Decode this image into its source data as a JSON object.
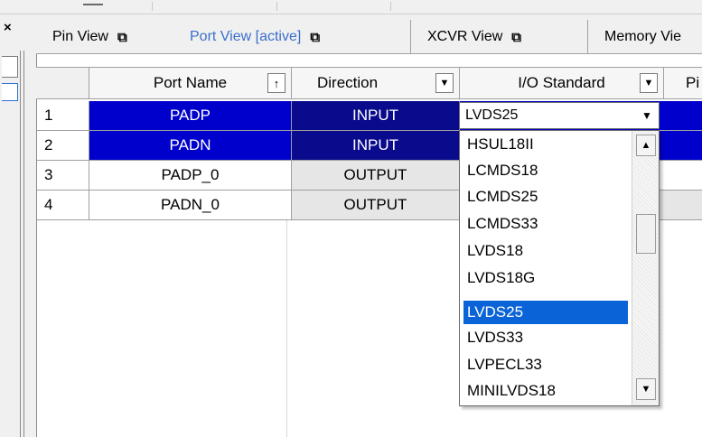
{
  "tabs": [
    {
      "label": "Pin View",
      "active": false
    },
    {
      "label": "Port View [active]",
      "active": true
    },
    {
      "label": "XCVR View",
      "active": false
    },
    {
      "label": "Memory Vie",
      "active": false
    }
  ],
  "table": {
    "columns": [
      "Port Name",
      "Direction",
      "I/O Standard",
      "Pi"
    ],
    "sort_indicator": "↑",
    "dropdown_indicator": "▼",
    "rows": [
      {
        "index": "1",
        "port_name": "PADP",
        "direction": "INPUT",
        "io_standard": "LVDS25"
      },
      {
        "index": "2",
        "port_name": "PADN",
        "direction": "INPUT",
        "io_standard": ""
      },
      {
        "index": "3",
        "port_name": "PADP_0",
        "direction": "OUTPUT",
        "io_standard": ""
      },
      {
        "index": "4",
        "port_name": "PADN_0",
        "direction": "OUTPUT",
        "io_standard": ""
      }
    ]
  },
  "io_dropdown": {
    "selected_value": "LVDS25",
    "options": [
      "HSUL18II",
      "LCMDS18",
      "LCMDS25",
      "LCMDS33",
      "LVDS18",
      "LVDS18G",
      "LVDS25",
      "LVDS33",
      "LVPECL33",
      "MINILVDS18"
    ],
    "highlighted": "LVDS25"
  },
  "icons": {
    "window": "restore-window-icon",
    "close": "close-icon"
  },
  "colors": {
    "row_selected": "#0000cc",
    "direction_selected": "#0a0a8c",
    "list_highlight": "#0a64d8",
    "active_tab_text": "#3a6fcc"
  }
}
